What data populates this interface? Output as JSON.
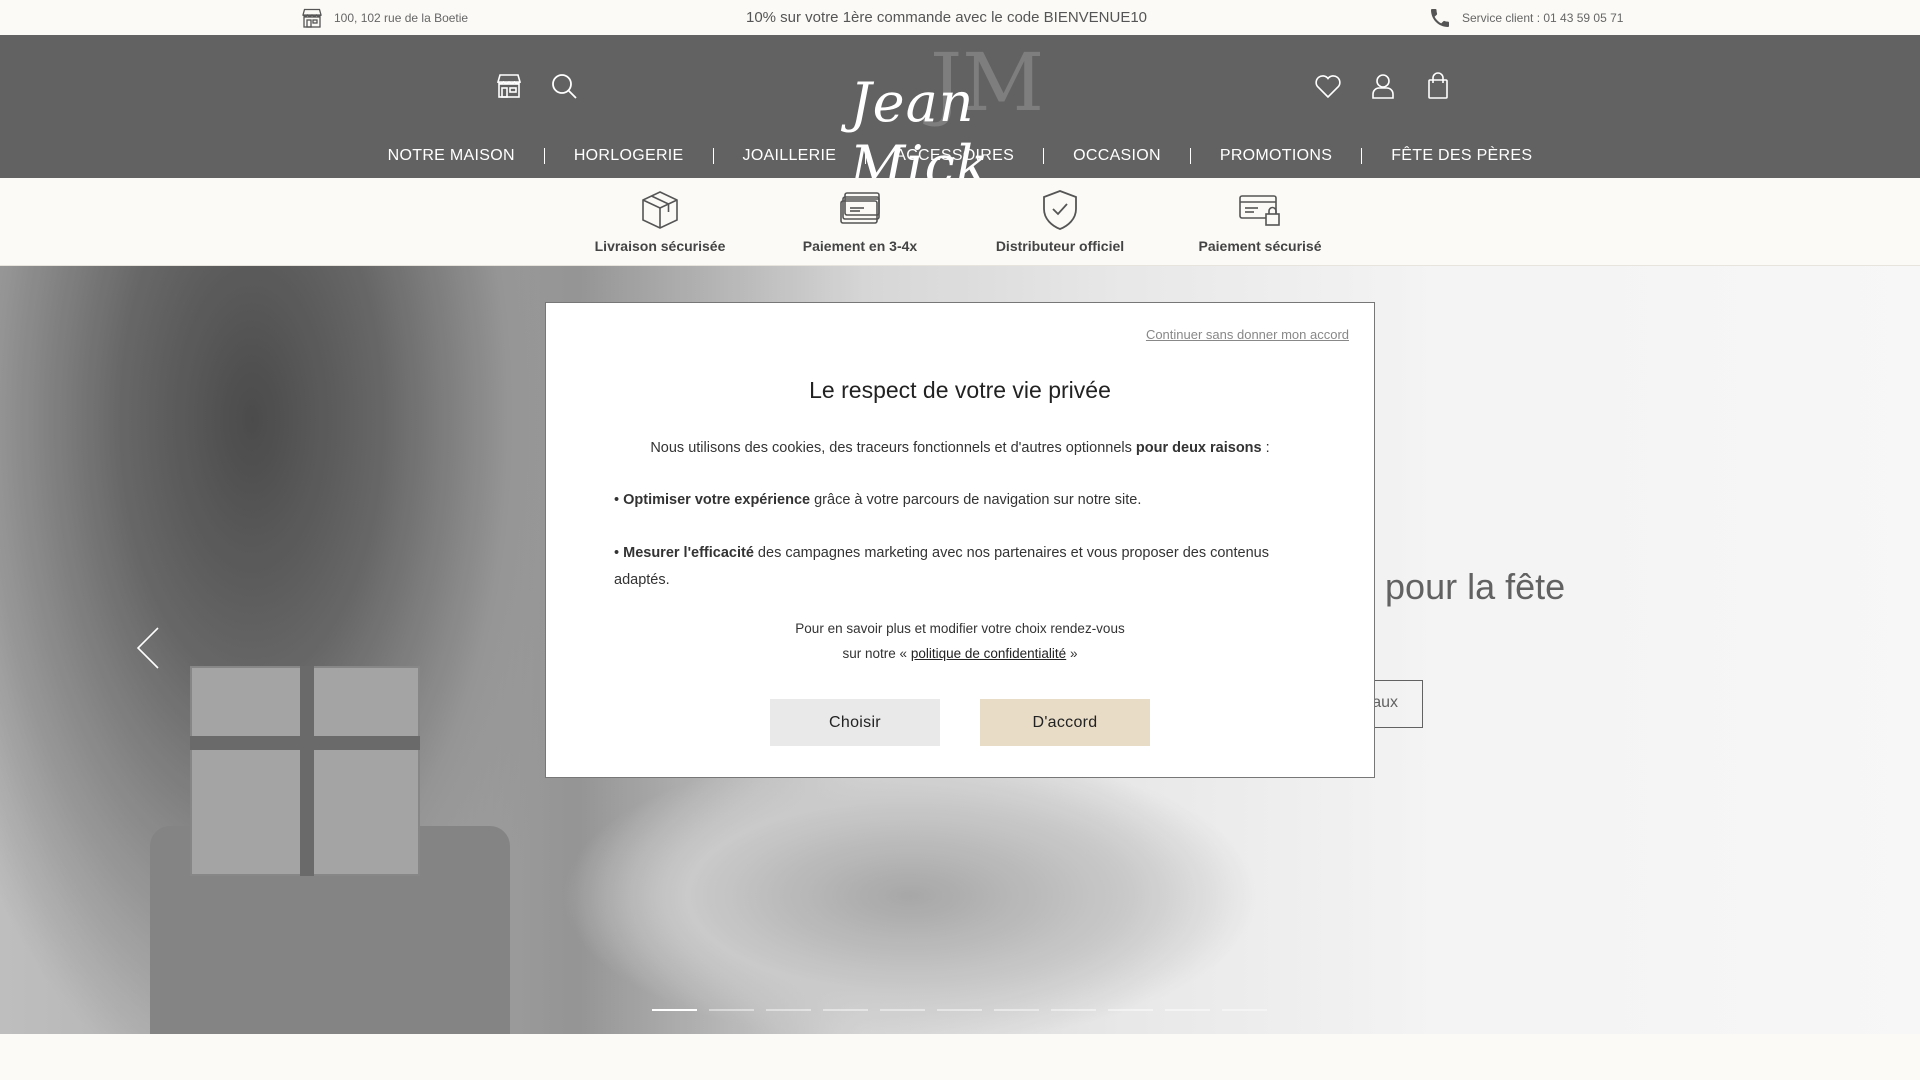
{
  "topbar": {
    "address": "100, 102 rue de la Boetie",
    "promo": "10% sur votre 1ère commande avec le code BIENVENUE10",
    "service": "Service client : 01 43 59 05 71"
  },
  "header": {
    "logo_text": "Jean Mick",
    "logo_monogram": "JM",
    "icons": [
      "store-icon",
      "search-icon",
      "heart-icon",
      "user-icon",
      "bag-icon"
    ],
    "nav": [
      "NOTRE MAISON",
      "HORLOGERIE",
      "JOAILLERIE",
      "ACCESSOIRES",
      "OCCASION",
      "PROMOTIONS",
      "FÊTE DES PÈRES"
    ]
  },
  "features": [
    {
      "label": "Livraison sécurisée",
      "icon": "box-icon"
    },
    {
      "label": "Paiement en 3-4x",
      "icon": "cards-icon"
    },
    {
      "label": "Distributeur officiel",
      "icon": "shield-check-icon"
    },
    {
      "label": "Paiement sécurisé",
      "icon": "secure-payment-icon"
    }
  ],
  "hero": {
    "headline_partial": "n pour la fête",
    "cta_partial": "aux",
    "slide_count": 11,
    "active_slide": 1
  },
  "cookie_modal": {
    "skip_link": "Continuer sans donner mon accord",
    "title": "Le respect de votre vie privée",
    "intro_text": "Nous utilisons des cookies, des traceurs fonctionnels et d'autres optionnels ",
    "intro_bold": "pour deux raisons",
    "intro_end": " :",
    "bullet1_bold": "Optimiser votre expérience",
    "bullet1_text": " grâce à votre parcours de navigation sur notre site.",
    "bullet2_bold": "Mesurer l'efficacité",
    "bullet2_text": " des campagnes marketing avec nos partenaires et vous proposer des contenus adaptés.",
    "more_line1": "Pour en savoir plus et modifier votre choix rendez-vous",
    "more_line2_prefix": "sur notre « ",
    "more_link": "politique de confidentialité",
    "more_line2_suffix": " »",
    "choose_label": "Choisir",
    "accept_label": "D'accord"
  },
  "colors": {
    "header_bg": "#626262",
    "page_bg": "#fbfaf6",
    "accept_bg": "#e8dcc6",
    "choose_bg": "#e9e9e9"
  }
}
